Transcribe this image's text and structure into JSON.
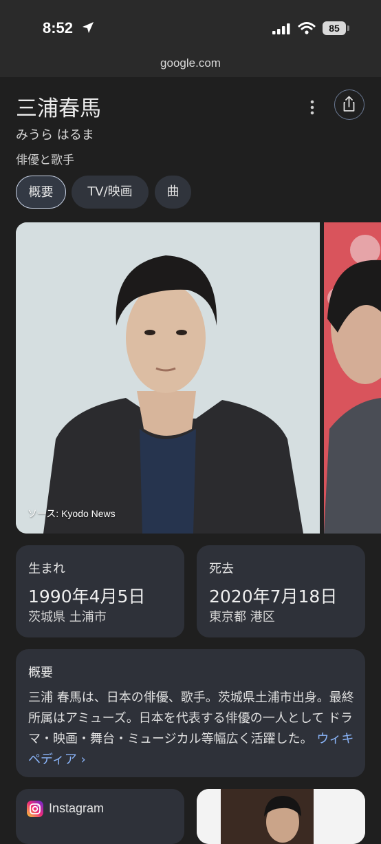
{
  "status": {
    "time": "8:52",
    "battery": "85"
  },
  "browser": {
    "url": "google.com"
  },
  "entity": {
    "name": "三浦春馬",
    "reading": "みうら はるま",
    "description": "俳優と歌手"
  },
  "tabs": [
    {
      "label": "概要",
      "selected": true
    },
    {
      "label": "TV/映画",
      "selected": false
    },
    {
      "label": "曲",
      "selected": false
    }
  ],
  "photo": {
    "credit": "ソース: Kyodo News"
  },
  "facts": {
    "born": {
      "label": "生まれ",
      "date": "1990年4月5日",
      "place": "茨城県 土浦市"
    },
    "died": {
      "label": "死去",
      "date": "2020年7月18日",
      "place": "東京都 港区"
    }
  },
  "overview": {
    "label": "概要",
    "text": "三浦 春馬は、日本の俳優、歌手。茨城県土浦市出身。最終所属はアミューズ。日本を代表する俳優の一人として ドラマ・映画・舞台・ミュージカル等幅広く活躍した。",
    "link": "ウィキペディア ›"
  },
  "social": {
    "label": "Instagram"
  },
  "colors": {
    "background": "#1f1f1f",
    "card": "#2e3139",
    "link": "#8ab4f8",
    "chip_border": "#c9d3e6"
  },
  "icons": [
    "location-arrow-icon",
    "signal-icon",
    "wifi-icon",
    "more-vert-icon",
    "share-icon",
    "instagram-icon"
  ]
}
